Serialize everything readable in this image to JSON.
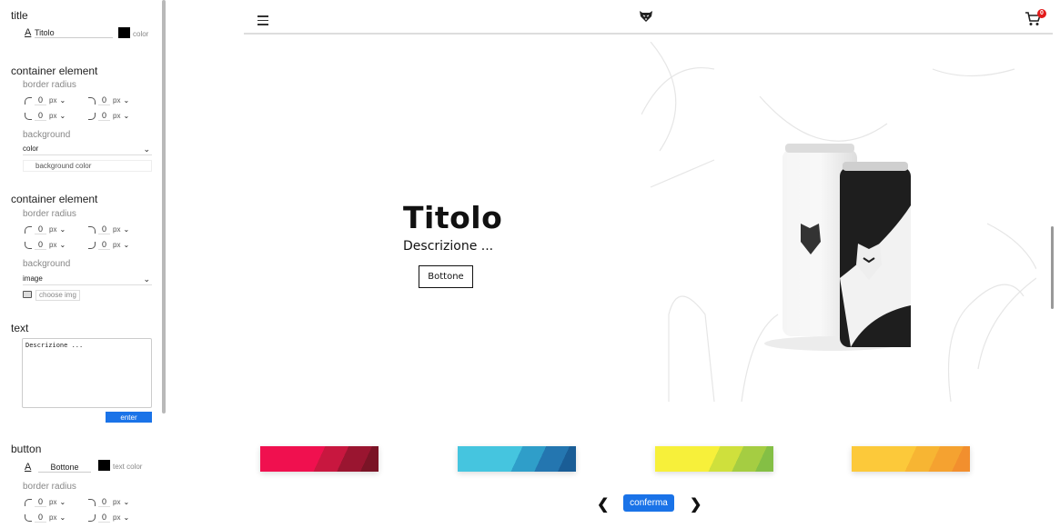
{
  "panel": {
    "title_section": {
      "heading": "title",
      "input_value": "Titolo",
      "color_label": "color",
      "color": "#000000"
    },
    "container1": {
      "heading": "container element",
      "radius_label": "border radius",
      "radius": {
        "tl": "0",
        "tr": "0",
        "bl": "0",
        "br": "0",
        "unit": "px"
      },
      "background_label": "background",
      "background_value": "color",
      "bgcolor_label": "background color"
    },
    "container2": {
      "heading": "container element",
      "radius_label": "border radius",
      "radius": {
        "tl": "0",
        "tr": "0",
        "bl": "0",
        "br": "0",
        "unit": "px"
      },
      "background_label": "background",
      "background_value": "image",
      "choose_label": "choose img"
    },
    "text_section": {
      "heading": "text",
      "value": "Descrizione ...",
      "enter_label": "enter"
    },
    "button_section": {
      "heading": "button",
      "input_value": "Bottone",
      "text_color_label": "text color",
      "radius_label": "border radius",
      "radius": {
        "tl": "0",
        "tr": "0",
        "bl": "0",
        "br": "0",
        "unit": "px"
      }
    }
  },
  "header": {
    "cart_count": "0"
  },
  "hero": {
    "title": "Titolo",
    "description": "Descrizione ...",
    "button_label": "Bottone"
  },
  "palettes": [
    {
      "colors": [
        "#f0104f",
        "#c8173f",
        "#9a1530",
        "#7a1426"
      ]
    },
    {
      "colors": [
        "#45c5df",
        "#2f9ec9",
        "#2476b0",
        "#1a5d96"
      ]
    },
    {
      "colors": [
        "#f7f03a",
        "#cfe03c",
        "#a5cd42",
        "#84bf45"
      ]
    },
    {
      "colors": [
        "#fcc93a",
        "#f7b533",
        "#f5a230",
        "#f28f2e"
      ]
    }
  ],
  "nav": {
    "confirm_label": "conferma"
  }
}
